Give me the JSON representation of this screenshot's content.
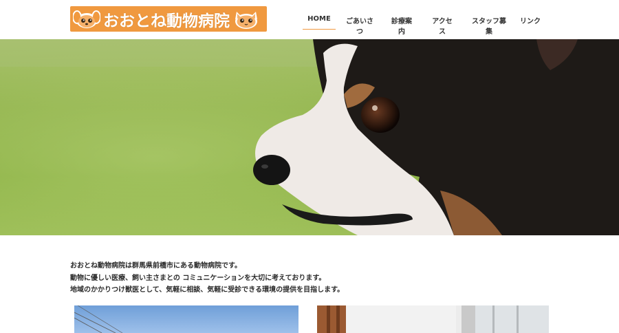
{
  "header": {
    "logo_title": "おおとね動物病院"
  },
  "nav": {
    "items": [
      {
        "label": "HOME",
        "active": true
      },
      {
        "label": "ごあいさつ",
        "active": false
      },
      {
        "label": "診療案内",
        "active": false
      },
      {
        "label": "アクセス",
        "active": false
      },
      {
        "label": "スタッフ募集",
        "active": false
      },
      {
        "label": "リンク",
        "active": false
      }
    ]
  },
  "intro": {
    "lines": [
      "おおとね動物病院は群馬県前橋市にある動物病院です。",
      "動物に優しい医療、飼い主さまとの コミュニケーションを大切に考えております。",
      "地域のかかりつけ獣医として、気軽に相談、気軽に受診できる環境の提供を目指します。"
    ]
  },
  "colors": {
    "accent": "#f0993f",
    "text": "#2b2b2b"
  }
}
